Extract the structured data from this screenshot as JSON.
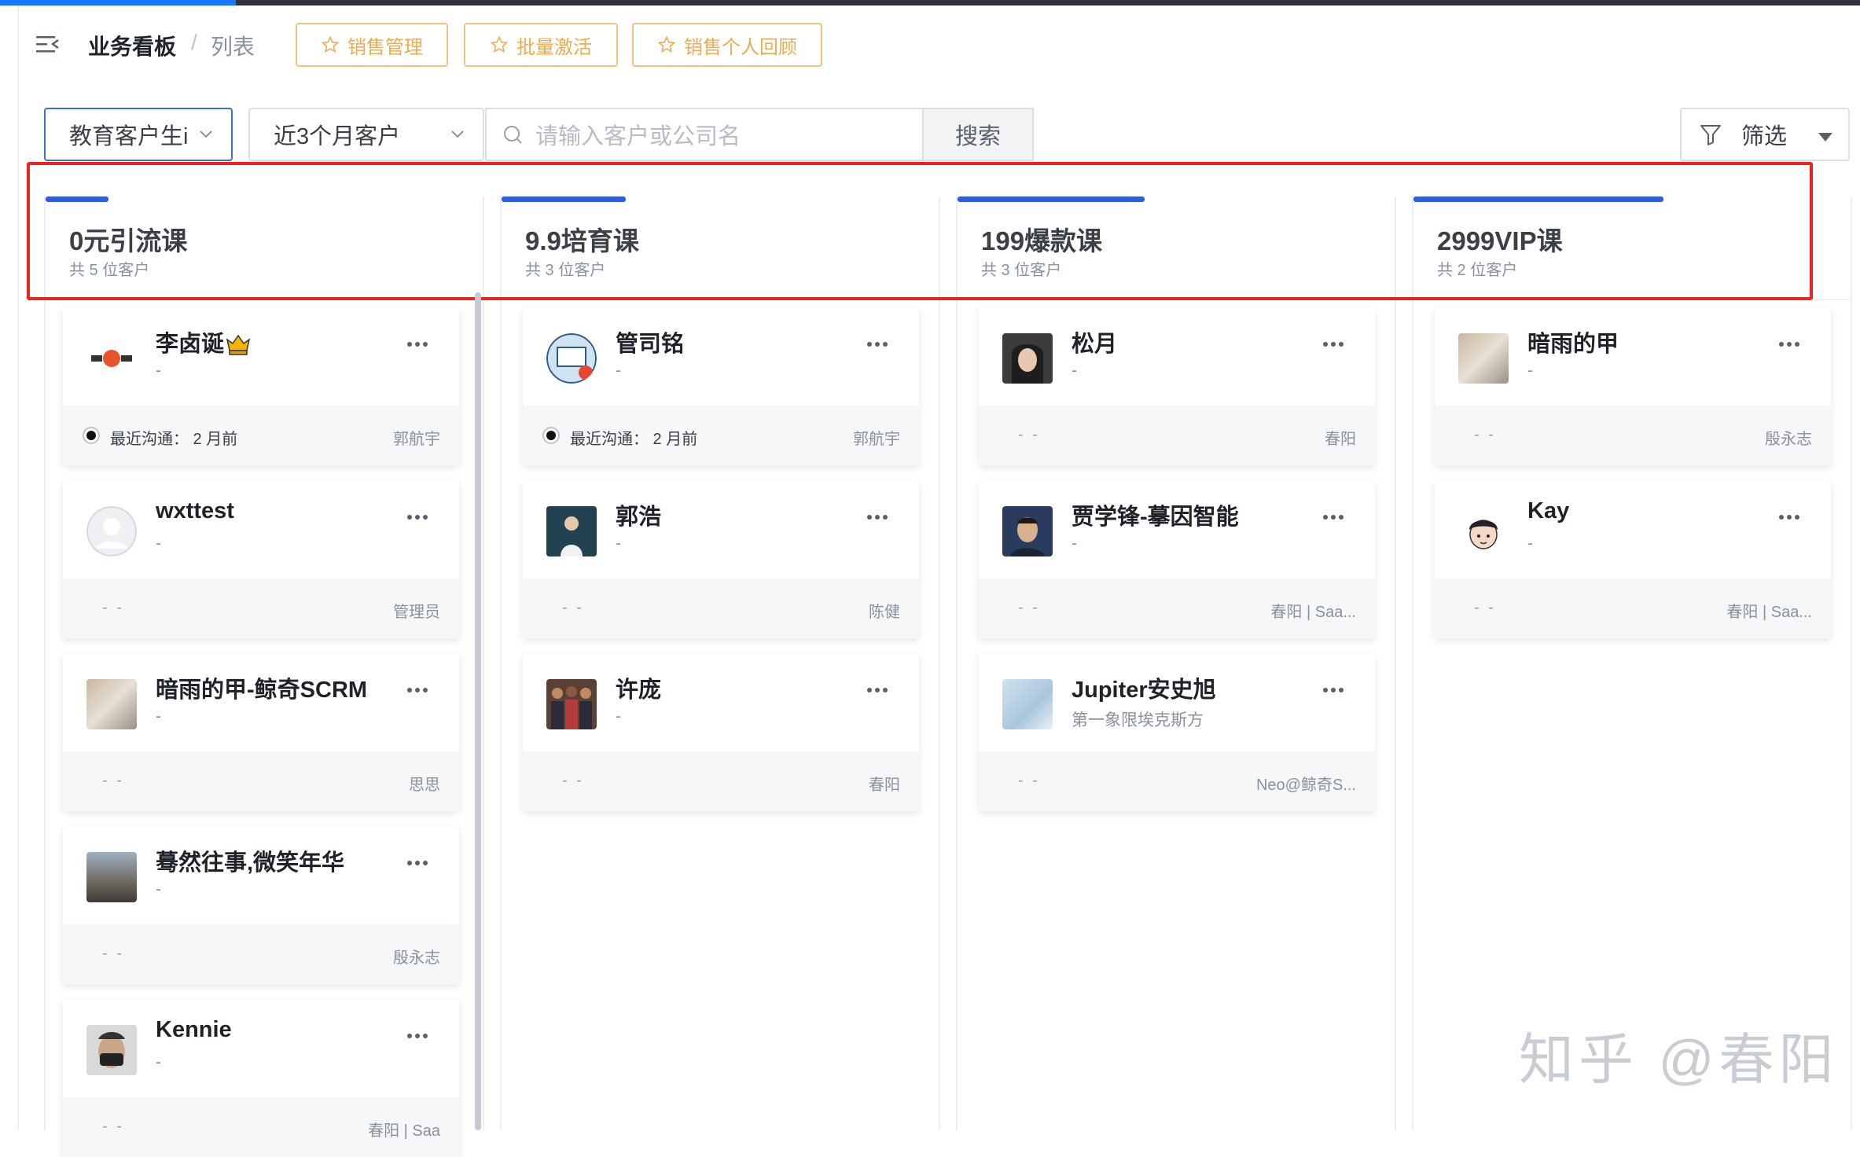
{
  "header": {
    "breadcrumb_main": "业务看板",
    "breadcrumb_sep": "/",
    "breadcrumb_sub": "列表",
    "tag_buttons": [
      "销售管理",
      "批量激活",
      "销售个人回顾"
    ]
  },
  "filters": {
    "select1_value": "教育客户生i",
    "select2_value": "近3个月客户",
    "search_placeholder": "请输入客户或公司名",
    "search_button": "搜索",
    "filter_button": "筛选"
  },
  "columns": [
    {
      "title": "0元引流课",
      "count": "共 5 位客户",
      "cards": [
        {
          "name": "李卤诞",
          "subtitle": "-",
          "footer_left": "最近沟通：  2 月前",
          "footer_right": "郭航宇",
          "avatar_text": "李卤诞"
        },
        {
          "name": "wxttest",
          "subtitle": "-",
          "footer_left": "- -",
          "footer_right": "管理员"
        },
        {
          "name": "暗雨的甲-鲸奇SCRM",
          "subtitle": "-",
          "footer_left": "- -",
          "footer_right": "思思"
        },
        {
          "name": "蓦然往事,微笑年华",
          "subtitle": "-",
          "footer_left": "- -",
          "footer_right": "殷永志"
        },
        {
          "name": "Kennie",
          "subtitle": "-",
          "footer_left": "- -",
          "footer_right": "春阳  |  Saa"
        }
      ]
    },
    {
      "title": "9.9培育课",
      "count": "共 3 位客户",
      "cards": [
        {
          "name": "管司铭",
          "subtitle": "-",
          "footer_left": "最近沟通：  2 月前",
          "footer_right": "郭航宇"
        },
        {
          "name": "郭浩",
          "subtitle": "-",
          "footer_left": "- -",
          "footer_right": "陈健"
        },
        {
          "name": "许庞",
          "subtitle": "-",
          "footer_left": "- -",
          "footer_right": "春阳"
        }
      ]
    },
    {
      "title": "199爆款课",
      "count": "共 3 位客户",
      "cards": [
        {
          "name": "松月",
          "subtitle": "-",
          "footer_left": "- -",
          "footer_right": "春阳"
        },
        {
          "name": "贾学锋-摹因智能",
          "subtitle": "-",
          "footer_left": "- -",
          "footer_right": "春阳  |  Saa..."
        },
        {
          "name": "Jupiter安史旭",
          "subtitle": "第一象限埃克斯方",
          "footer_left": "- -",
          "footer_right": "Neo@鲸奇S..."
        }
      ]
    },
    {
      "title": "2999VIP课",
      "count": "共 2 位客户",
      "cards": [
        {
          "name": "暗雨的甲",
          "subtitle": "-",
          "footer_left": "- -",
          "footer_right": "殷永志"
        },
        {
          "name": "Kay",
          "subtitle": "-",
          "footer_left": "- -",
          "footer_right": "春阳  |  Saa..."
        }
      ]
    }
  ],
  "watermark": "知乎 @春阳",
  "colors": {
    "accent": "#2f5ee0",
    "tag": "#efab4c",
    "highlight": "#e8261f"
  }
}
